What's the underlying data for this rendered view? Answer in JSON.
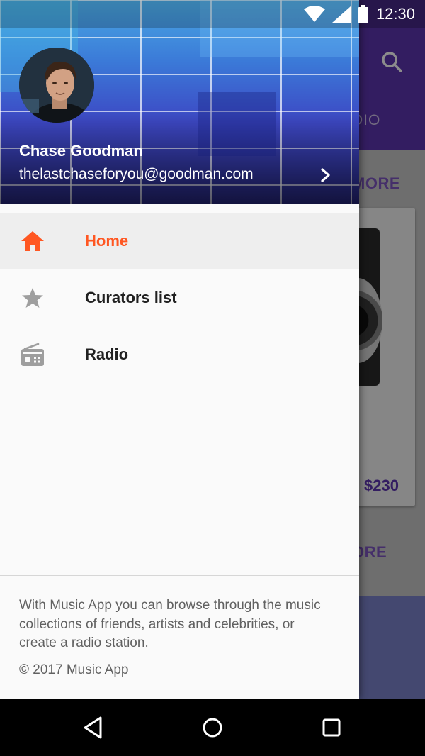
{
  "status_bar": {
    "time": "12:30",
    "icons": [
      "wifi-icon",
      "signal-icon",
      "battery-icon"
    ]
  },
  "background_app": {
    "tab_partial": "DIO",
    "more_label_1": "MORE",
    "price": "$230",
    "more_label_2": "ORE",
    "appbar_color": "#5e35b1"
  },
  "drawer": {
    "header": {
      "name": "Chase Goodman",
      "email": "thelastchaseforyou@goodman.com"
    },
    "items": [
      {
        "label": "Home",
        "icon": "home-icon",
        "active": true
      },
      {
        "label": "Curators list",
        "icon": "star-icon",
        "active": false
      },
      {
        "label": "Radio",
        "icon": "radio-icon",
        "active": false
      }
    ],
    "footer": {
      "description": "With Music App you can browse through the music collections of friends, artists and celebrities, or create a radio station.",
      "copyright": "© 2017 Music App"
    }
  },
  "colors": {
    "accent": "#ff5722",
    "inactive_icon": "#9e9e9e",
    "primary": "#5e35b1"
  },
  "system_nav": [
    "back-icon",
    "home-circle-icon",
    "recents-icon"
  ]
}
